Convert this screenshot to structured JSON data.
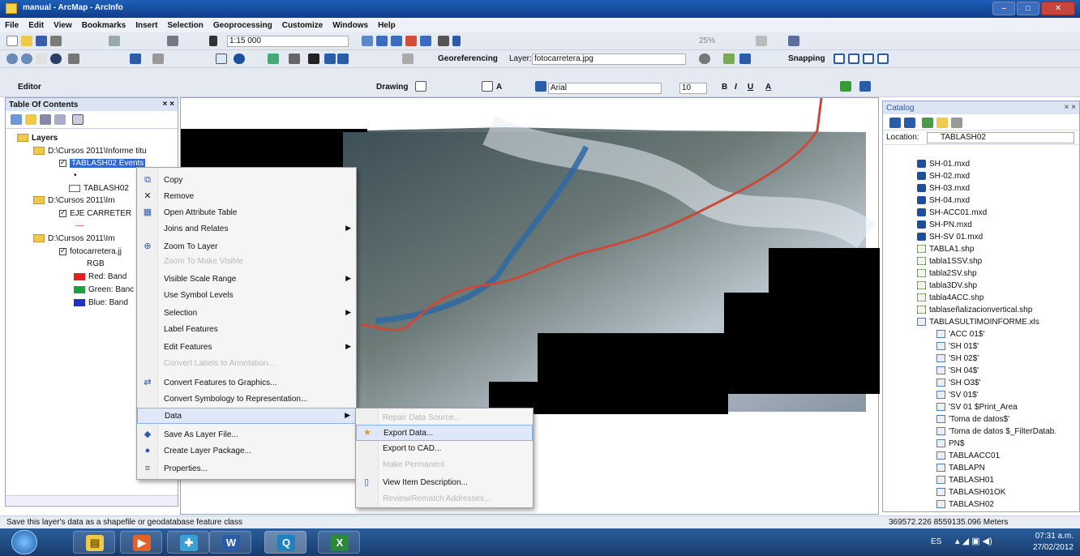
{
  "window": {
    "title": "manual - ArcMap - ArcInfo"
  },
  "menu": [
    "File",
    "Edit",
    "View",
    "Bookmarks",
    "Insert",
    "Selection",
    "Geoprocessing",
    "Customize",
    "Windows",
    "Help"
  ],
  "toolbar": {
    "scale": "1:15 000",
    "georef_label": "Georeferencing",
    "layer_label": "Layer:",
    "layer_value": "fotocarretera.jpg",
    "snapping_label": "Snapping",
    "editor_label": "Editor",
    "drawing_label": "Drawing",
    "font_name": "Arial",
    "font_size": "10",
    "bold": "B",
    "italic": "I",
    "underline": "U",
    "zoom_pct": "25%"
  },
  "toc": {
    "title": "Table Of Contents",
    "close": "× ×",
    "layers_label": "Layers",
    "items": [
      {
        "text": "D:\\Cursos 2011\\Informe titu"
      },
      {
        "text": "TABLASH02 Events"
      },
      {
        "text": "•"
      },
      {
        "text": "TABLASH02"
      },
      {
        "text": "D:\\Cursos 2011\\Im"
      },
      {
        "text": "EJE CARRETER"
      },
      {
        "text": "—"
      },
      {
        "text": "D:\\Cursos 2011\\Im"
      },
      {
        "text": "fotocarretera.jj"
      },
      {
        "text": "RGB"
      },
      {
        "text": "Red:  Band"
      },
      {
        "text": "Green: Banc"
      },
      {
        "text": "Blue:  Band"
      }
    ],
    "colors": {
      "red": "#e02020",
      "green": "#1ea040",
      "blue": "#2030c0"
    }
  },
  "context_menu": [
    {
      "label": "Copy",
      "icon": "copy-icon",
      "arrow": false,
      "disabled": false
    },
    {
      "label": "Remove",
      "icon": "remove-icon",
      "arrow": false,
      "disabled": false
    },
    {
      "label": "Open Attribute Table",
      "icon": "table-icon",
      "arrow": false,
      "disabled": false
    },
    {
      "label": "Joins and Relates",
      "icon": "",
      "arrow": true,
      "disabled": false
    },
    {
      "label": "Zoom To Layer",
      "icon": "zoom-layer-icon",
      "arrow": false,
      "disabled": false
    },
    {
      "label": "Zoom To Make Visible",
      "icon": "",
      "arrow": false,
      "disabled": true
    },
    {
      "label": "Visible Scale Range",
      "icon": "",
      "arrow": true,
      "disabled": false
    },
    {
      "label": "Use Symbol Levels",
      "icon": "",
      "arrow": false,
      "disabled": false
    },
    {
      "label": "Selection",
      "icon": "",
      "arrow": true,
      "disabled": false
    },
    {
      "label": "Label Features",
      "icon": "",
      "arrow": false,
      "disabled": false
    },
    {
      "label": "Edit Features",
      "icon": "",
      "arrow": true,
      "disabled": false
    },
    {
      "label": "Convert Labels to Annotation...",
      "icon": "",
      "arrow": false,
      "disabled": true
    },
    {
      "label": "Convert Features to Graphics...",
      "icon": "convert-graphics-icon",
      "arrow": false,
      "disabled": false
    },
    {
      "label": "Convert Symbology to Representation...",
      "icon": "",
      "arrow": false,
      "disabled": false
    },
    {
      "label": "Data",
      "icon": "",
      "arrow": true,
      "disabled": false,
      "highlight": true
    },
    {
      "label": "Save As Layer File...",
      "icon": "save-layer-icon",
      "arrow": false,
      "disabled": false
    },
    {
      "label": "Create Layer Package...",
      "icon": "package-icon",
      "arrow": false,
      "disabled": false
    },
    {
      "label": "Properties...",
      "icon": "properties-icon",
      "arrow": false,
      "disabled": false
    }
  ],
  "submenu": [
    {
      "label": "Repair Data Source...",
      "disabled": true,
      "icon": ""
    },
    {
      "label": "Export Data...",
      "disabled": false,
      "highlight": true,
      "icon": "export-data-icon"
    },
    {
      "label": "Export to CAD...",
      "disabled": false,
      "icon": ""
    },
    {
      "label": "Make Permanent",
      "disabled": true,
      "icon": ""
    },
    {
      "label": "View Item Description...",
      "disabled": false,
      "icon": "item-description-icon"
    },
    {
      "label": "Review/Rematch Addresses...",
      "disabled": true,
      "icon": ""
    }
  ],
  "catalog": {
    "title": "Catalog",
    "close": "× ×",
    "location_label": "Location:",
    "location_value": "TABLASH02",
    "items": [
      {
        "text": "SH-01.mxd",
        "type": "mxd",
        "indent": 0
      },
      {
        "text": "SH-02.mxd",
        "type": "mxd",
        "indent": 0
      },
      {
        "text": "SH-03.mxd",
        "type": "mxd",
        "indent": 0
      },
      {
        "text": "SH-04.mxd",
        "type": "mxd",
        "indent": 0
      },
      {
        "text": "SH-ACC01.mxd",
        "type": "mxd",
        "indent": 0
      },
      {
        "text": "SH-PN.mxd",
        "type": "mxd",
        "indent": 0
      },
      {
        "text": "SH-SV 01.mxd",
        "type": "mxd",
        "indent": 0
      },
      {
        "text": "TABLA1.shp",
        "type": "shp",
        "indent": 0
      },
      {
        "text": "tabla1SSV.shp",
        "type": "shp",
        "indent": 0
      },
      {
        "text": "tabla2SV.shp",
        "type": "shp",
        "indent": 0
      },
      {
        "text": "tabla3DV.shp",
        "type": "shp",
        "indent": 0
      },
      {
        "text": "tabla4ACC.shp",
        "type": "shp",
        "indent": 0
      },
      {
        "text": "tablaseñalizacionvertical.shp",
        "type": "shp",
        "indent": 0
      },
      {
        "text": "TABLASULTIMOINFORME.xls",
        "type": "xls",
        "indent": 0
      },
      {
        "text": "'ACC 01$'",
        "type": "tbl",
        "indent": 1
      },
      {
        "text": "'SH 01$'",
        "type": "tbl",
        "indent": 1
      },
      {
        "text": "'SH 02$'",
        "type": "tbl",
        "indent": 1
      },
      {
        "text": "'SH 04$'",
        "type": "tbl",
        "indent": 1
      },
      {
        "text": "'SH O3$'",
        "type": "tbl",
        "indent": 1
      },
      {
        "text": "'SV 01$'",
        "type": "tbl",
        "indent": 1
      },
      {
        "text": "'SV 01 $Print_Area",
        "type": "tbl",
        "indent": 1
      },
      {
        "text": "'Toma de datos$'",
        "type": "tbl",
        "indent": 1
      },
      {
        "text": "'Toma de datos $_FilterDatab.",
        "type": "tbl",
        "indent": 1
      },
      {
        "text": "PN$",
        "type": "tbl",
        "indent": 1
      },
      {
        "text": "TABLAACC01",
        "type": "tbl",
        "indent": 1
      },
      {
        "text": "TABLAPN",
        "type": "tbl",
        "indent": 1
      },
      {
        "text": "TABLASH01",
        "type": "tbl",
        "indent": 1
      },
      {
        "text": "TABLASH01OK",
        "type": "tbl",
        "indent": 1
      },
      {
        "text": "TABLASH02",
        "type": "tbl",
        "indent": 1
      }
    ]
  },
  "status": {
    "message": "Save this layer's data as a shapefile or geodatabase feature class",
    "coords": "369572.226  8559135.096 Meters"
  },
  "taskbar": {
    "lang": "ES",
    "time": "07:31 a.m.",
    "date": "27/02/2012",
    "apps": [
      "start-orb",
      "explorer-app",
      "media-app",
      "network-app",
      "word-app",
      "arcmap-app",
      "excel-app"
    ]
  }
}
